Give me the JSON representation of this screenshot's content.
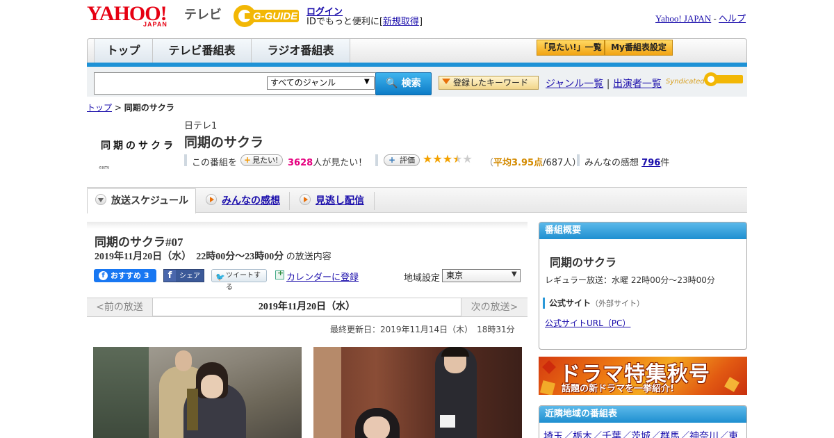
{
  "header": {
    "yahoo_logo": "YAHOO!",
    "yahoo_japan": "JAPAN",
    "tv_label": "テレビ",
    "gguide_logo": "G-GUIDE",
    "login": "ログイン",
    "id_text_prefix": "IDでもっと便利に[",
    "id_register": "新規取得",
    "id_text_suffix": "]",
    "yahoo_japan_link": "Yahoo! JAPAN",
    "separator": "-",
    "help": "ヘルプ"
  },
  "nav": {
    "tabs": [
      {
        "label": "トップ"
      },
      {
        "label": "テレビ番組表"
      },
      {
        "label": "ラジオ番組表"
      }
    ],
    "mitai_list": "「見たい!」一覧",
    "my_settings": "My番組表設定"
  },
  "search": {
    "value": "",
    "genre_selected": "すべてのジャンル",
    "search_button": "検索",
    "keyword_button": "登録したキーワード",
    "genre_list": "ジャンル一覧",
    "divider": "|",
    "cast_list": "出演者一覧",
    "syndicated": "Syndicated"
  },
  "breadcrumb": {
    "top": "トップ",
    "sep": ">",
    "current": "同期のサクラ"
  },
  "program": {
    "logo_text": "同期のサクラ",
    "logo_credit": "©NTV",
    "channel": "日テレ1",
    "title": "同期のサクラ",
    "mitai_prefix": "この番組を",
    "mitai_button": "見たい!",
    "mitai_count": "3628",
    "mitai_suffix": "人が見たい！",
    "rate_button": "評価",
    "rating": 3.95,
    "rating_open": "（",
    "rating_avg": "平均3.95点",
    "rating_count": "/687人）",
    "review_prefix": "みんなの感想",
    "review_count": "796",
    "review_suffix": "件"
  },
  "tabs": {
    "schedule": "放送スケジュール",
    "reviews": "みんなの感想",
    "streaming": "見逃し配信"
  },
  "episode": {
    "title": "同期のサクラ#07",
    "datetime": "2019年11月20日（水）　22時00分～23時00分",
    "datetime_suffix": "の放送内容",
    "fb_recommend": "おすすめ 3",
    "fb_share": "シェア",
    "tweet": "ツイートする",
    "calendar": "カレンダーに登録",
    "region_label": "地域設定",
    "region_value": "東京",
    "prev": "<前の放送",
    "current_date": "2019年11月20日（水）",
    "next": "次の放送>",
    "updated": "最終更新日：2019年11月14日（木）　18時31分"
  },
  "overview": {
    "header": "番組概要",
    "title": "同期のサクラ",
    "regular": "レギュラー放送：水曜 22時00分～23時00分",
    "official_label": "公式サイト",
    "official_note": "（外部サイト）",
    "official_url": "公式サイトURL（PC）"
  },
  "banner": {
    "line1": "ドラマ特集秋号",
    "line2": "話題の新ドラマを一挙紹介!"
  },
  "nearby": {
    "header": "近隣地域の番組表",
    "links": "埼玉／栃木／千葉／茨城／群馬／神奈川／東"
  },
  "colors": {
    "accent_blue": "#1e92d6",
    "yahoo_red": "#e60012",
    "mitai_pink": "#e5007f",
    "star_gold": "#f3a200"
  }
}
